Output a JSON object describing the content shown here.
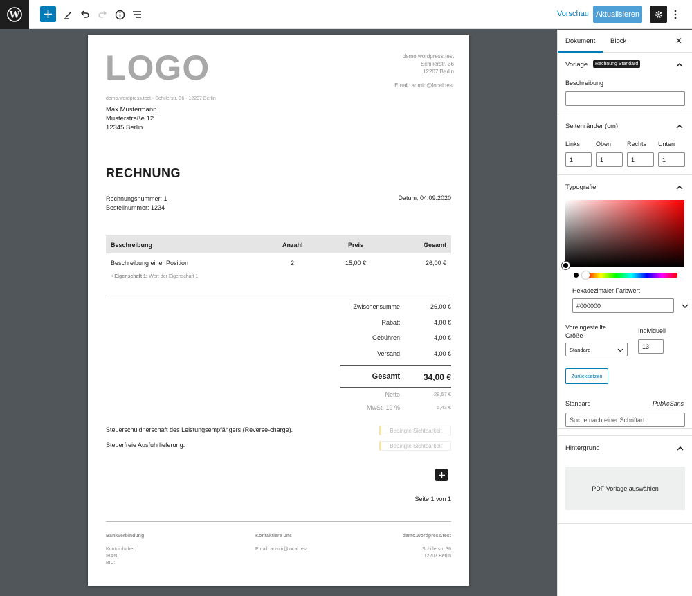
{
  "toolbar": {
    "preview_label": "Vorschau",
    "update_label": "Aktualisieren"
  },
  "invoice": {
    "logo": "LOGO",
    "sender": [
      "demo.wordpress.test",
      "Schillerstr. 36",
      "12207 Berlin"
    ],
    "sender_email": "Email: admin@local.test",
    "return_line": "demo.wordpress.test - Schillerstr. 36 - 12207 Berlin",
    "recipient": [
      "Max Mustermann",
      "Musterstraße 12",
      "12345 Berlin"
    ],
    "title": "RECHNUNG",
    "invoice_number": "Rechnungsnummer: 1",
    "order_number": "Bestellnummer: 1234",
    "date": "Datum: 04.09.2020",
    "columns": [
      "Beschreibung",
      "Anzahl",
      "Preis",
      "Gesamt"
    ],
    "item": {
      "description": "Beschreibung einer Position",
      "qty": "2",
      "price": "15,00 €",
      "total": "26,00 €",
      "property_label": "Eigenschaft 1:",
      "property_value": "Wert der Eigenschaft 1"
    },
    "totals": [
      {
        "label": "Zwischensumme",
        "value": "26,00 €"
      },
      {
        "label": "Rabatt",
        "value": "-4,00 €"
      },
      {
        "label": "Gebühren",
        "value": "4,00 €"
      },
      {
        "label": "Versand",
        "value": "4,00 €"
      }
    ],
    "grand_total": {
      "label": "Gesamt",
      "value": "34,00 €"
    },
    "net": {
      "label": "Netto",
      "value": "28,57 €"
    },
    "vat": {
      "label": "MwSt. 19 %",
      "value": "5,43 €"
    },
    "notice_reverse": "Steuerschuldnerschaft des Leistungsempfängers (Reverse-charge).",
    "notice_export": "Steuerfreie Ausfuhrlieferung.",
    "conditional_badge": "Bedingte Sichtbarkeit",
    "page_number": "Seite 1 von 1",
    "footer": {
      "bank_title": "Bankverbindung",
      "bank_lines": [
        "Kontoinhaber:",
        "IBAN:",
        "BIC:"
      ],
      "contact_title": "Kontaktiere uns",
      "contact_line": "Email: admin@local.test",
      "company_title": "demo.wordpress.test",
      "company_lines": [
        "Schillerstr. 36",
        "12207 Berlin"
      ]
    }
  },
  "sidebar": {
    "tab_document": "Dokument",
    "tab_block": "Block",
    "template": {
      "title": "Vorlage",
      "badge": "Rechnung Standard",
      "description_label": "Beschreibung",
      "description_value": ""
    },
    "margins": {
      "title": "Seitenränder (cm)",
      "left_label": "Links",
      "left_value": "1",
      "top_label": "Oben",
      "top_value": "1",
      "right_label": "Rechts",
      "right_value": "1",
      "bottom_label": "Unten",
      "bottom_value": "1"
    },
    "typography": {
      "title": "Typografie",
      "hex_label": "Hexadezimaler Farbwert",
      "hex_value": "#000000",
      "preset_size_label": "Voreingestellte Größe",
      "preset_size_value": "Standard",
      "custom_label": "Individuell",
      "custom_value": "13",
      "reset_label": "Zurücksetzen",
      "font_label": "Standard",
      "font_value": "PublicSans",
      "font_search_placeholder": "Suche nach einer Schriftart"
    },
    "background": {
      "title": "Hintergrund",
      "pdf_button": "PDF Vorlage auswählen"
    }
  },
  "colors": {
    "accent": "#007cba",
    "dark": "#1e1e1e"
  }
}
